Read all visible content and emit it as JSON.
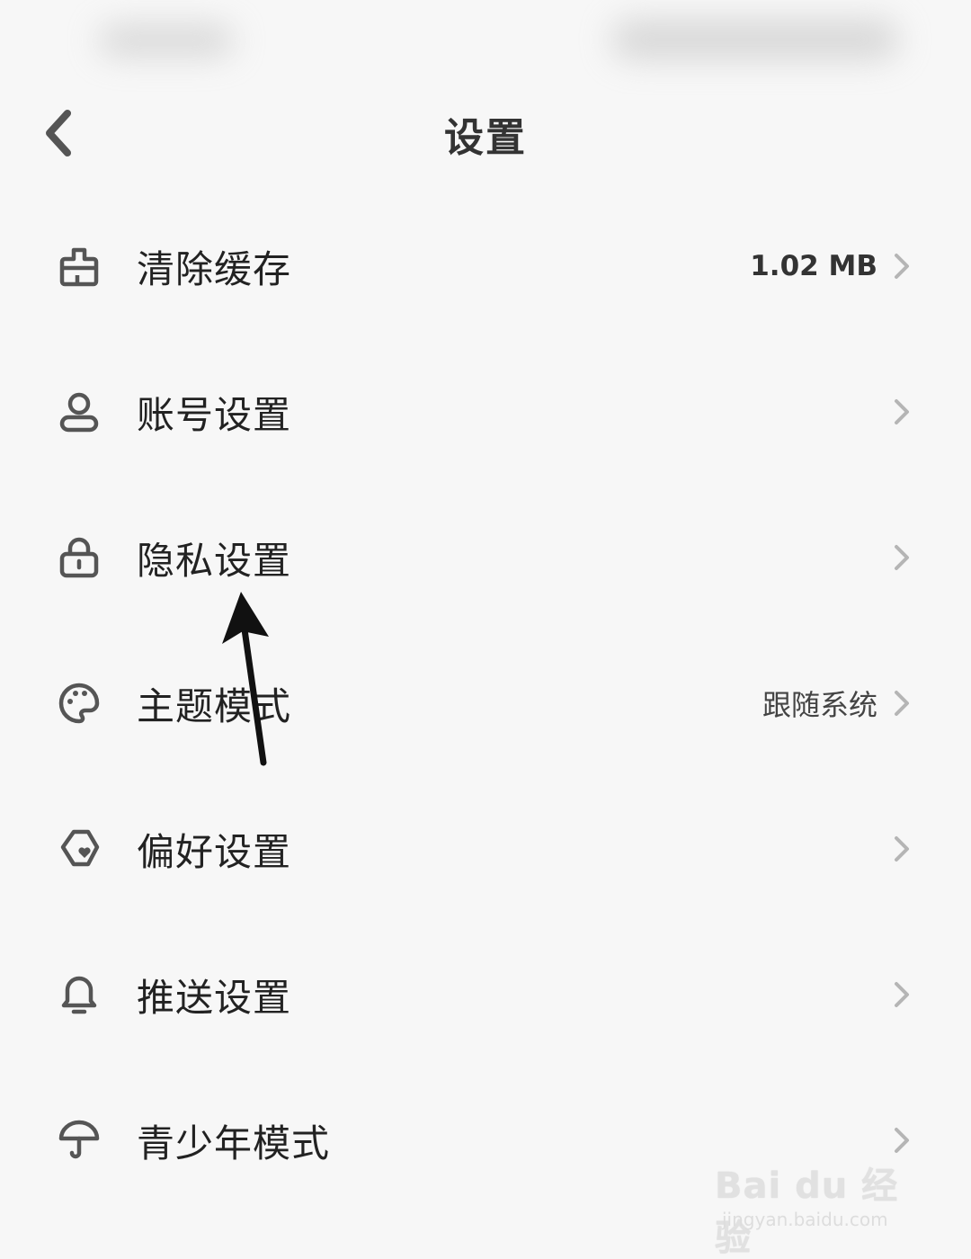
{
  "header": {
    "title": "设置"
  },
  "menu": {
    "items": [
      {
        "label": "清除缓存",
        "value": "1.02 MB",
        "icon": "broom-icon"
      },
      {
        "label": "账号设置",
        "value": "",
        "icon": "user-icon"
      },
      {
        "label": "隐私设置",
        "value": "",
        "icon": "lock-icon"
      },
      {
        "label": "主题模式",
        "value": "跟随系统",
        "icon": "palette-icon"
      },
      {
        "label": "偏好设置",
        "value": "",
        "icon": "shield-heart-icon"
      },
      {
        "label": "推送设置",
        "value": "",
        "icon": "bell-icon"
      },
      {
        "label": "青少年模式",
        "value": "",
        "icon": "umbrella-icon"
      }
    ]
  },
  "watermark": {
    "brand": "Bai du 经验",
    "url": "jingyan.baidu.com"
  },
  "colors": {
    "background": "#f7f7f7",
    "icon_stroke": "#555555",
    "chevron": "#b5b5b5"
  }
}
